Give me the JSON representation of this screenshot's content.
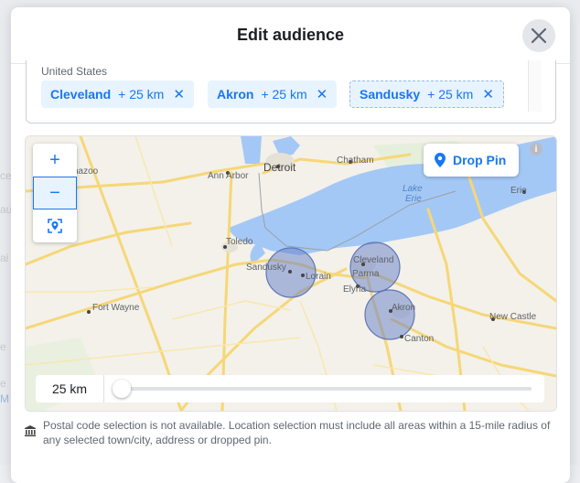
{
  "modal": {
    "title": "Edit audience"
  },
  "locations": {
    "country": "United States",
    "chips": [
      {
        "city": "Cleveland",
        "radius": "+ 25 km"
      },
      {
        "city": "Akron",
        "radius": "+ 25 km"
      },
      {
        "city": "Sandusky",
        "radius": "+ 25 km"
      }
    ],
    "remove_glyph": "✕"
  },
  "map": {
    "drop_pin_label": "Drop Pin",
    "zoom_in": "+",
    "zoom_out": "−",
    "labels": {
      "detroit": "Detroit",
      "ann_arbor": "Ann Arbor",
      "chatham": "Chatham",
      "lake_erie_1": "Lake",
      "lake_erie_2": "Erie",
      "erie": "Erie",
      "toledo": "Toledo",
      "sandusky": "Sandusky",
      "lorain": "Lorain",
      "cleveland": "Cleveland",
      "parma": "Parma",
      "elyria": "Elyria",
      "akron": "Akron",
      "canton": "Canton",
      "new_castle": "New Castle",
      "fort_wayne": "Fort Wayne",
      "kalamazoo": "nazoo"
    },
    "info_glyph": "i"
  },
  "radius_slider": {
    "value": "25 km",
    "level": 0
  },
  "note": {
    "text": "Postal code selection is not available. Location selection must include all areas within a 15-mile radius of any selected town/city, address or dropped pin."
  },
  "colors": {
    "accent": "#1877f2",
    "chip_bg": "#e7f3ff",
    "water": "#a4c8f5",
    "highway": "#f6d777",
    "radius_circle": "#7e96cf"
  },
  "background": {
    "left_texts": [
      "ce",
      "au",
      "ai",
      "e",
      "e",
      "M"
    ]
  }
}
